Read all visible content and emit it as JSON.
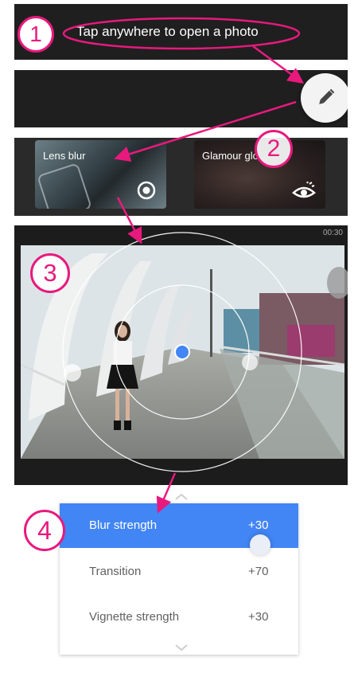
{
  "tip": {
    "text": "Tap anywhere to open a photo"
  },
  "markers": [
    "1",
    "2",
    "3",
    "4"
  ],
  "filters": [
    {
      "label": "Lens blur",
      "icon": "radio-target-icon"
    },
    {
      "label": "Glamour glo",
      "icon": "eye-icon"
    }
  ],
  "editor": {
    "timestamp": "00:30"
  },
  "adjustments": [
    {
      "label": "Blur strength",
      "value": "+30",
      "selected": true
    },
    {
      "label": "Transition",
      "value": "+70",
      "selected": false
    },
    {
      "label": "Vignette strength",
      "value": "+30",
      "selected": false
    }
  ],
  "colors": {
    "accent": "#4285f4",
    "annotation": "#e8197d",
    "panel": "#1f1f1f"
  }
}
